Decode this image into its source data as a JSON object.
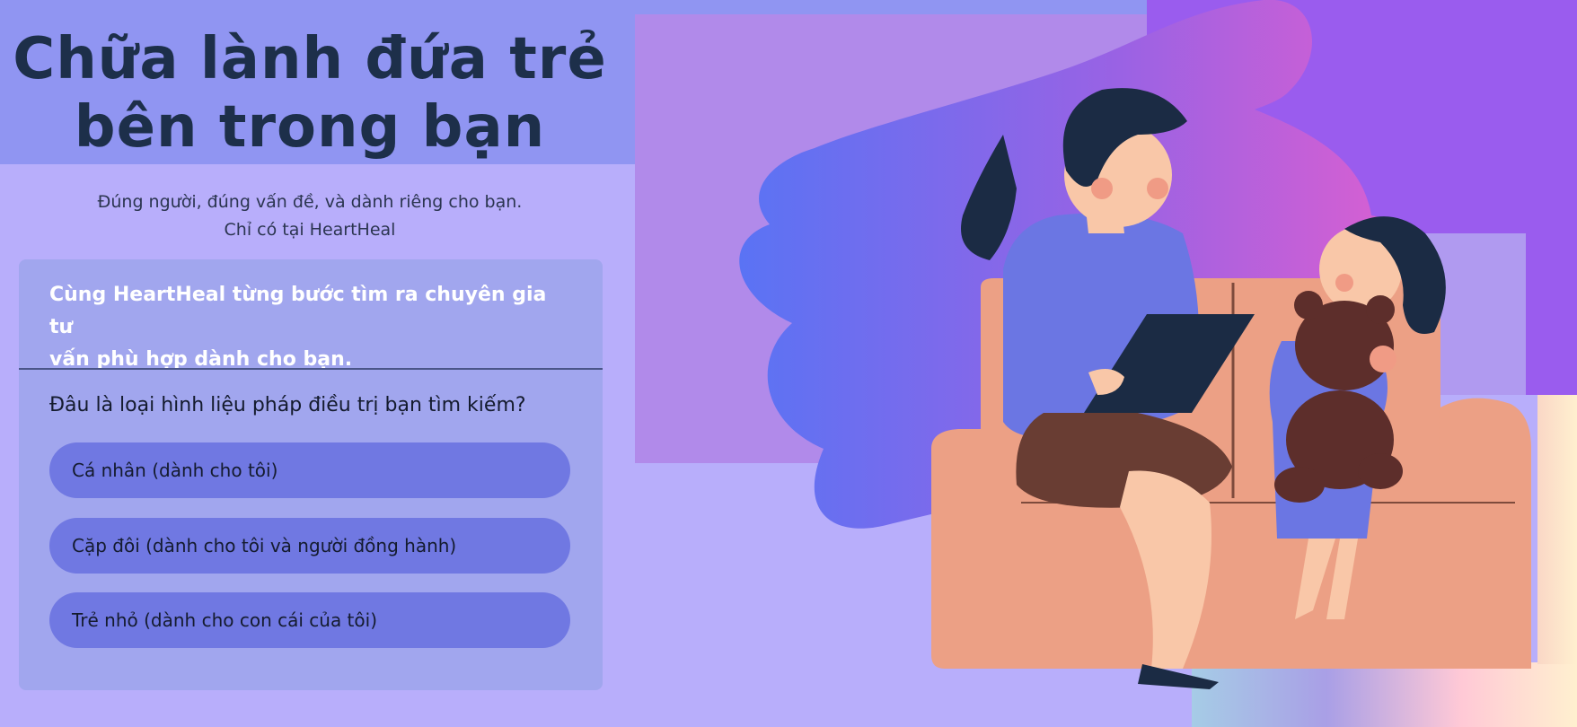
{
  "hero": {
    "title_line1": "Chữa lành đứa trẻ",
    "title_line2": "bên trong bạn",
    "subtitle_line1": "Đúng người, đúng vấn đề, và dành riêng cho bạn.",
    "subtitle_line2": "Chỉ có tại HeartHeal"
  },
  "card": {
    "heading_line1": "Cùng HeartHeal từng bước tìm ra chuyên gia tư",
    "heading_line2": "vấn phù hợp dành cho bạn.",
    "question": "Đâu là loại hình liệu pháp điều trị bạn tìm kiếm?",
    "options": [
      {
        "label": "Cá nhân (dành cho tôi)"
      },
      {
        "label": "Cặp đôi (dành cho tôi và người đồng hành)"
      },
      {
        "label": "Trẻ nhỏ (dành cho con cái của tôi)"
      }
    ]
  },
  "colors": {
    "background": "#b8aefb",
    "hero_band": "#9095f2",
    "card": "#a1a6ee",
    "option": "#7078e2",
    "title": "#1d2f4a"
  },
  "illustration": {
    "subject": "therapist-with-child-illustration"
  }
}
